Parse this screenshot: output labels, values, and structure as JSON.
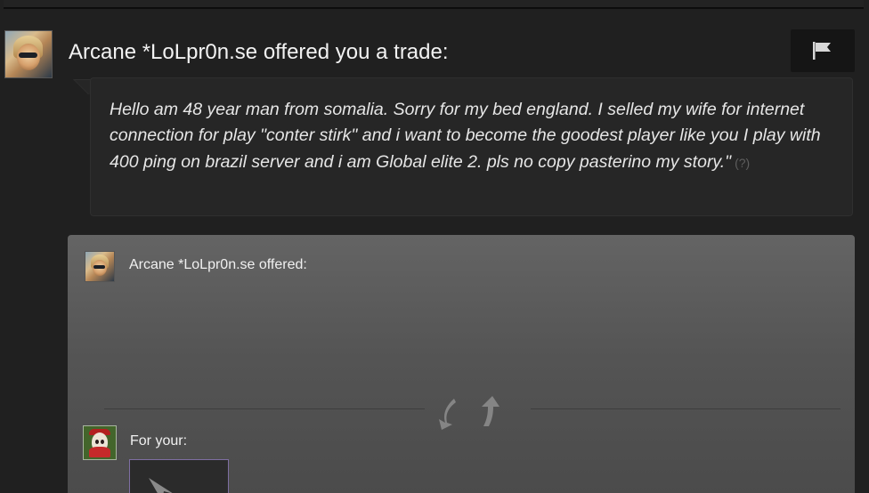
{
  "trade_offer": {
    "title": "Arcane *LoLpr0n.se offered you a trade:",
    "report_button": {
      "icon": "flag-icon"
    },
    "message": "Hello am 48 year man from somalia. Sorry for my bed england. I selled my wife for internet connection for play \"conter stirk\" and i want to become the goodest player like you I play with 400 ping on brazil server and i am Global elite 2. pls no copy pasterino my story.\"",
    "help_link": "(?)"
  },
  "trade_panel": {
    "their_offer_label": "Arcane *LoLpr0n.se offered:",
    "your_items_label": "For your:",
    "swap_icon": "swap-arrows-icon",
    "item_icon": "cursor-arrow-icon"
  },
  "colors": {
    "background": "#202020",
    "message_box": "#262626",
    "panel_top": "#646464",
    "panel_bottom": "#4a4a4a",
    "item_border": "#7e6ea3",
    "text": "#f2f2f2"
  }
}
